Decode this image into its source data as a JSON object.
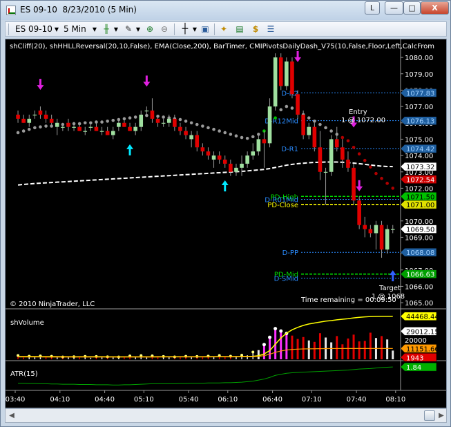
{
  "window": {
    "title": "ES 09-10  8/23/2010 (5 Min)",
    "buttons": {
      "help": "L",
      "minimize": "—",
      "maximize": "□",
      "close": "X"
    }
  },
  "toolbar": {
    "instrument": "ES 09-10",
    "interval": "5 Min",
    "icons": [
      "candlestick-style-icon",
      "drawing-pencil-icon",
      "zoom-in-icon",
      "zoom-out-icon",
      "crosshair-icon",
      "properties-icon",
      "strategy-icon",
      "indicators-icon",
      "currency-icon",
      "data-box-icon"
    ]
  },
  "price_panel": {
    "header": "shCliff(20), shHHLLReversal(20,10,False), EMA(Close,200), BarTimer, CMIPivotsDailyDash_V75(10,False,Floor,Left,CalcFrom",
    "copyright": "© 2010 NinjaTrader, LLC",
    "time_remaining": "Time remaining = 00:09:50",
    "entry_label": "Entry",
    "entry_value": "1 @ 1072.00",
    "target_label": "Target",
    "target_value": "1 @ 1068",
    "pivot_lines": [
      {
        "label": "D-R2",
        "price": 1077.83,
        "color": "#2a8cff",
        "badge": "1077.83",
        "badge_bg": "#1f5fa0",
        "badge_fg": "#9fd0ff"
      },
      {
        "label": "D-R12Mid",
        "price": 1076.13,
        "color": "#2a8cff",
        "badge": "1076.13",
        "badge_bg": "#1f5fa0",
        "badge_fg": "#9fd0ff"
      },
      {
        "label": "D-R1",
        "price": 1074.42,
        "color": "#2a8cff",
        "badge": "1074.42",
        "badge_bg": "#1f5fa0",
        "badge_fg": "#9fd0ff"
      },
      {
        "label": "PD-High",
        "price": 1071.5,
        "color": "#00e000",
        "badge": "1071.50",
        "badge_bg": "#00c000",
        "badge_fg": "#000000"
      },
      {
        "label": "D-R01Mid",
        "price": 1071.32,
        "color": "#2a8cff",
        "badge": "",
        "badge_bg": "",
        "badge_fg": ""
      },
      {
        "label": "PD-Close",
        "price": 1071.0,
        "color": "#ffff00",
        "badge": "1071.00",
        "badge_bg": "#e0e000",
        "badge_fg": "#000000"
      },
      {
        "label": "D-PP",
        "price": 1068.08,
        "color": "#2a8cff",
        "badge": "1068.08",
        "badge_bg": "#1f5fa0",
        "badge_fg": "#9fd0ff"
      },
      {
        "label": "PD-Mid",
        "price": 1066.75,
        "color": "#00e000",
        "badge": "1066.63",
        "badge_bg": "#00a000",
        "badge_fg": "#ffffff"
      },
      {
        "label": "D-SMid",
        "price": 1066.5,
        "color": "#2a8cff",
        "badge": "",
        "badge_bg": "",
        "badge_fg": ""
      }
    ],
    "price_badges": [
      {
        "text": "1073.32",
        "price": 1073.32,
        "bg": "#ffffff",
        "fg": "#000000"
      },
      {
        "text": "1072.54",
        "price": 1072.54,
        "bg": "#d00000",
        "fg": "#ffffff"
      },
      {
        "text": "1069.50",
        "price": 1069.5,
        "bg": "#ffffff",
        "fg": "#000000"
      }
    ]
  },
  "volume_panel": {
    "title": "shVolume",
    "badges": [
      {
        "text": "44468.44",
        "value": 44468,
        "bg": "#ffff00",
        "fg": "#000000"
      },
      {
        "text": "29012.15",
        "value": 29012,
        "bg": "#ffffff",
        "fg": "#000000"
      },
      {
        "text": "11151.66",
        "value": 11151,
        "bg": "#ff9900",
        "fg": "#000000"
      },
      {
        "text": "1943",
        "value": 1943,
        "bg": "#e00000",
        "fg": "#ffffff"
      }
    ]
  },
  "atr_panel": {
    "title": "ATR(15)",
    "badge": {
      "text": "1.84",
      "value": 1.84,
      "bg": "#00b000",
      "fg": "#ffffff"
    }
  },
  "chart_data": {
    "type": "candlestick",
    "x": [
      "03:40",
      "04:10",
      "04:40",
      "05:10",
      "05:40",
      "06:10",
      "06:40",
      "07:10",
      "07:40",
      "08:10"
    ],
    "price_ticks": [
      1080.0,
      1079.0,
      1078.0,
      1077.0,
      1076.0,
      1075.0,
      1074.0,
      1073.0,
      1072.0,
      1071.0,
      1070.0,
      1069.0,
      1068.0,
      1067.0,
      1066.0,
      1065.0
    ],
    "price_tick_labels": [
      "1080.00",
      "1079.00",
      "1078.00",
      "1077.00",
      "1076.00",
      "1075.00",
      "1074.00",
      "1073.00",
      "1072.00",
      "1071.00",
      "1070.00",
      "1069.00",
      "1068.00",
      "1067.00",
      "1066.00",
      "1065.00"
    ],
    "ylim": [
      1064.75,
      1080.3
    ],
    "volume_ticks": [
      20000
    ],
    "volume_tick_labels": [
      "20000"
    ],
    "volume_ylim": [
      0,
      50000
    ],
    "candles": [
      [
        1076.5,
        1076.75,
        1076.0,
        1076.25
      ],
      [
        1076.25,
        1076.5,
        1076.0,
        1076.0
      ],
      [
        1076.0,
        1076.5,
        1075.75,
        1076.25
      ],
      [
        1076.5,
        1076.75,
        1076.25,
        1076.5
      ],
      [
        1076.75,
        1077.0,
        1076.25,
        1076.5
      ],
      [
        1076.5,
        1076.75,
        1076.0,
        1076.25
      ],
      [
        1076.25,
        1076.5,
        1075.75,
        1076.0
      ],
      [
        1075.75,
        1076.25,
        1075.25,
        1076.0
      ],
      [
        1075.75,
        1076.0,
        1075.5,
        1075.75
      ],
      [
        1076.0,
        1076.25,
        1075.5,
        1075.75
      ],
      [
        1075.75,
        1076.0,
        1075.5,
        1075.75
      ],
      [
        1075.75,
        1076.0,
        1075.5,
        1075.5
      ],
      [
        1075.5,
        1075.75,
        1075.25,
        1075.5
      ],
      [
        1075.75,
        1076.0,
        1075.5,
        1075.75
      ],
      [
        1075.75,
        1076.0,
        1075.5,
        1075.5
      ],
      [
        1075.5,
        1075.75,
        1075.25,
        1075.5
      ],
      [
        1075.5,
        1075.75,
        1075.25,
        1075.25
      ],
      [
        1075.25,
        1075.75,
        1075.0,
        1075.5
      ],
      [
        1075.75,
        1076.25,
        1075.5,
        1076.0
      ],
      [
        1076.0,
        1076.25,
        1075.75,
        1075.75
      ],
      [
        1075.75,
        1076.0,
        1075.5,
        1075.5
      ],
      [
        1075.5,
        1076.0,
        1075.25,
        1075.75
      ],
      [
        1075.75,
        1076.75,
        1075.5,
        1076.5
      ],
      [
        1076.75,
        1077.0,
        1076.5,
        1076.75
      ],
      [
        1076.75,
        1077.5,
        1076.0,
        1076.25
      ],
      [
        1076.25,
        1076.5,
        1075.75,
        1076.0
      ],
      [
        1076.0,
        1076.25,
        1075.75,
        1076.0
      ],
      [
        1076.0,
        1076.5,
        1075.75,
        1076.25
      ],
      [
        1076.25,
        1076.5,
        1075.5,
        1075.75
      ],
      [
        1075.75,
        1076.0,
        1075.25,
        1075.5
      ],
      [
        1075.5,
        1075.75,
        1075.0,
        1075.25
      ],
      [
        1075.0,
        1075.5,
        1074.5,
        1075.25
      ],
      [
        1075.25,
        1075.5,
        1074.25,
        1074.5
      ],
      [
        1074.5,
        1074.75,
        1074.0,
        1074.25
      ],
      [
        1074.25,
        1074.5,
        1073.75,
        1074.0
      ],
      [
        1073.75,
        1074.25,
        1073.25,
        1074.0
      ],
      [
        1074.0,
        1074.25,
        1073.5,
        1073.75
      ],
      [
        1073.75,
        1074.0,
        1073.25,
        1073.5
      ],
      [
        1073.5,
        1073.75,
        1072.75,
        1073.0
      ],
      [
        1073.0,
        1073.5,
        1072.75,
        1073.25
      ],
      [
        1073.25,
        1074.0,
        1072.75,
        1073.5
      ],
      [
        1073.5,
        1074.25,
        1073.25,
        1074.0
      ],
      [
        1074.0,
        1074.75,
        1073.75,
        1074.25
      ],
      [
        1074.25,
        1075.25,
        1074.0,
        1075.0
      ],
      [
        1075.0,
        1075.5,
        1073.25,
        1074.75
      ],
      [
        1074.75,
        1077.5,
        1074.5,
        1077.0
      ],
      [
        1077.0,
        1080.25,
        1076.75,
        1080.0
      ],
      [
        1080.0,
        1080.25,
        1078.0,
        1078.25
      ],
      [
        1078.25,
        1080.0,
        1078.0,
        1079.75
      ],
      [
        1079.75,
        1080.0,
        1077.5,
        1077.75
      ],
      [
        1077.75,
        1078.0,
        1076.25,
        1076.5
      ],
      [
        1076.5,
        1076.75,
        1075.0,
        1075.25
      ],
      [
        1075.25,
        1076.0,
        1075.0,
        1075.75
      ],
      [
        1075.75,
        1076.0,
        1074.25,
        1074.5
      ],
      [
        1074.5,
        1075.5,
        1072.5,
        1073.0
      ],
      [
        1073.0,
        1073.25,
        1071.0,
        1073.0
      ],
      [
        1073.0,
        1075.25,
        1072.75,
        1075.0
      ],
      [
        1075.0,
        1075.75,
        1074.25,
        1074.5
      ],
      [
        1074.5,
        1075.0,
        1073.25,
        1073.75
      ],
      [
        1073.75,
        1074.25,
        1073.0,
        1073.25
      ],
      [
        1073.25,
        1073.5,
        1071.0,
        1071.25
      ],
      [
        1071.25,
        1071.5,
        1069.5,
        1069.75
      ],
      [
        1069.75,
        1070.25,
        1069.0,
        1069.5
      ],
      [
        1069.5,
        1069.75,
        1069.0,
        1069.25
      ],
      [
        1069.25,
        1070.0,
        1068.25,
        1069.75
      ],
      [
        1069.75,
        1070.0,
        1067.75,
        1068.25
      ],
      [
        1068.25,
        1069.75,
        1068.0,
        1069.5
      ],
      [
        1069.5,
        1069.75,
        1069.25,
        1069.5
      ]
    ],
    "cliff_dots": [
      1075.4,
      1075.5,
      1075.6,
      1075.7,
      1075.75,
      1075.8,
      1075.8,
      1075.85,
      1075.9,
      1075.9,
      1075.95,
      1075.95,
      1076.0,
      1076.0,
      1076.05,
      1076.05,
      1076.1,
      1076.15,
      1076.2,
      1076.25,
      1076.3,
      1076.35,
      1076.4,
      1076.45,
      1076.45,
      1076.4,
      1076.35,
      1076.3,
      1076.25,
      1076.2,
      1076.1,
      1076.0,
      1075.9,
      1075.8,
      1075.7,
      1075.6,
      1075.5,
      1075.4,
      1075.3,
      1075.2,
      1075.1,
      1075.05,
      1075.15,
      1075.3,
      1075.5,
      1075.8,
      1076.3,
      1076.8,
      1077.0,
      1076.9,
      1076.7,
      1076.5,
      1076.3,
      1076.1,
      1075.9,
      1075.7,
      1075.5,
      1075.3,
      1075.1,
      1074.9,
      1074.5,
      1074.1,
      1073.7,
      1073.3,
      1072.9,
      1072.6,
      1072.3,
      1072.0
    ],
    "ema200": [
      1072.2,
      1072.23,
      1072.26,
      1072.29,
      1072.31,
      1072.33,
      1072.35,
      1072.37,
      1072.39,
      1072.41,
      1072.43,
      1072.45,
      1072.47,
      1072.49,
      1072.51,
      1072.53,
      1072.55,
      1072.57,
      1072.59,
      1072.61,
      1072.63,
      1072.65,
      1072.67,
      1072.69,
      1072.71,
      1072.73,
      1072.75,
      1072.77,
      1072.79,
      1072.81,
      1072.83,
      1072.85,
      1072.87,
      1072.89,
      1072.91,
      1072.93,
      1072.95,
      1072.97,
      1072.99,
      1073.01,
      1073.03,
      1073.06,
      1073.09,
      1073.12,
      1073.15,
      1073.2,
      1073.27,
      1073.34,
      1073.41,
      1073.46,
      1073.5,
      1073.53,
      1073.56,
      1073.58,
      1073.59,
      1073.6,
      1073.6,
      1073.6,
      1073.59,
      1073.57,
      1073.54,
      1073.5,
      1073.46,
      1073.42,
      1073.38,
      1073.35,
      1073.33,
      1073.32
    ],
    "up_arrows": [
      {
        "bar": 20,
        "price": 1074.6
      },
      {
        "bar": 37,
        "price": 1072.4
      },
      {
        "bar": 67,
        "price": 1066.9
      }
    ],
    "down_arrows": [
      {
        "bar": 4,
        "price": 1078.1
      },
      {
        "bar": 23,
        "price": 1078.3
      },
      {
        "bar": 50,
        "price": 1079.8
      },
      {
        "bar": 60,
        "price": 1075.8
      },
      {
        "bar": 61,
        "price": 1071.9
      }
    ],
    "volumes": [
      3200,
      1800,
      2500,
      2100,
      2800,
      1900,
      2400,
      2200,
      1700,
      2600,
      2000,
      1800,
      2300,
      1600,
      2200,
      2500,
      1900,
      2100,
      1700,
      2400,
      2800,
      2300,
      3100,
      2600,
      2900,
      2000,
      2200,
      2500,
      1800,
      2100,
      2400,
      2700,
      2200,
      3000,
      2600,
      2300,
      3200,
      2800,
      2500,
      3400,
      3600,
      4200,
      6800,
      9500,
      14500,
      22000,
      31000,
      28500,
      26000,
      24500,
      21000,
      23000,
      19500,
      18000,
      27000,
      22500,
      17500,
      24000,
      15500,
      21500,
      25500,
      18500,
      19000,
      27500,
      22000,
      24000,
      20500,
      9000
    ],
    "volume_highlight": [
      false,
      false,
      false,
      false,
      false,
      false,
      false,
      false,
      false,
      false,
      false,
      false,
      false,
      false,
      false,
      false,
      false,
      false,
      false,
      false,
      false,
      false,
      false,
      false,
      false,
      false,
      false,
      false,
      false,
      false,
      false,
      false,
      false,
      false,
      false,
      false,
      false,
      false,
      false,
      false,
      false,
      false,
      false,
      false,
      true,
      true,
      true,
      true,
      true,
      false,
      false,
      false,
      false,
      false,
      false,
      false,
      false,
      false,
      false,
      false,
      false,
      false,
      false,
      false,
      false,
      false,
      false,
      false
    ],
    "volume_avg": [
      2900,
      2880,
      2850,
      2820,
      2800,
      2780,
      2760,
      2740,
      2720,
      2700,
      2690,
      2680,
      2670,
      2660,
      2650,
      2640,
      2630,
      2620,
      2610,
      2600,
      2600,
      2600,
      2610,
      2620,
      2630,
      2640,
      2650,
      2660,
      2670,
      2680,
      2690,
      2700,
      2710,
      2720,
      2730,
      2740,
      2760,
      2780,
      2800,
      2830,
      2870,
      2940,
      3100,
      3700,
      5500,
      9000,
      15500,
      22000,
      27000,
      30500,
      33000,
      35000,
      36500,
      37500,
      38500,
      39500,
      40000,
      40800,
      41400,
      42000,
      42800,
      43400,
      43800,
      44200,
      44400,
      44460,
      44468,
      44468
    ],
    "volume_avg2": [
      2400,
      2400,
      2380,
      2360,
      2350,
      2340,
      2330,
      2320,
      2310,
      2300,
      2300,
      2300,
      2300,
      2290,
      2290,
      2290,
      2290,
      2290,
      2290,
      2290,
      2300,
      2300,
      2310,
      2320,
      2330,
      2340,
      2350,
      2360,
      2370,
      2380,
      2390,
      2400,
      2410,
      2420,
      2430,
      2440,
      2460,
      2480,
      2500,
      2520,
      2550,
      2600,
      2700,
      3000,
      3800,
      5200,
      7200,
      8600,
      9600,
      10200,
      10500,
      10700,
      10800,
      10900,
      11000,
      11050,
      11100,
      11120,
      11140,
      11150,
      11150,
      11150,
      11151,
      11151,
      11151,
      11151,
      11151,
      11151
    ],
    "atr": [
      1.22,
      1.22,
      1.21,
      1.21,
      1.2,
      1.2,
      1.19,
      1.19,
      1.18,
      1.18,
      1.18,
      1.17,
      1.17,
      1.17,
      1.16,
      1.16,
      1.16,
      1.15,
      1.15,
      1.16,
      1.16,
      1.17,
      1.18,
      1.19,
      1.2,
      1.2,
      1.2,
      1.2,
      1.2,
      1.21,
      1.21,
      1.22,
      1.22,
      1.22,
      1.23,
      1.23,
      1.23,
      1.24,
      1.24,
      1.25,
      1.26,
      1.28,
      1.3,
      1.34,
      1.38,
      1.44,
      1.52,
      1.56,
      1.6,
      1.62,
      1.63,
      1.64,
      1.65,
      1.66,
      1.67,
      1.68,
      1.69,
      1.7,
      1.71,
      1.72,
      1.74,
      1.76,
      1.77,
      1.78,
      1.8,
      1.82,
      1.83,
      1.84
    ],
    "atr_ylim": [
      1.0,
      2.0
    ]
  }
}
